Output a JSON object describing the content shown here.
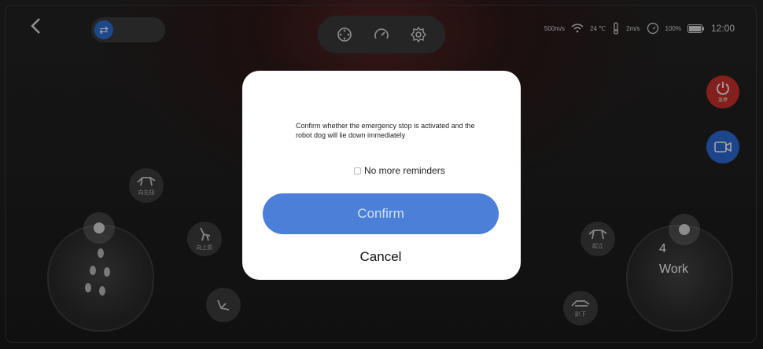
{
  "header": {
    "back_icon": "chevron-left-icon",
    "mode_toggle_icon": "swap-arrows-icon",
    "tools": [
      "crosshair-target-icon",
      "speedometer-icon",
      "gear-icon"
    ],
    "status": {
      "network": "500m/s",
      "temperature": "24 ℃",
      "speed": "2m/s",
      "battery": "100%",
      "time": "12:00"
    }
  },
  "side": {
    "estop_label": "急停",
    "camera_icon": "video-camera-icon"
  },
  "actions": {
    "left": [
      "向左扭",
      "向上抓",
      ""
    ],
    "right": [
      "起立",
      "趴下"
    ]
  },
  "joystick": {
    "speed_value": "4",
    "mode_label": "Work"
  },
  "dialog": {
    "message": "Confirm whether the emergency stop is activated and the robot dog will lie down immediately",
    "checkbox_label": "No more reminders",
    "checkbox_checked": false,
    "confirm_label": "Confirm",
    "cancel_label": "Cancel"
  },
  "colors": {
    "accent_blue": "#4b7fd8",
    "estop_red": "#c9302c",
    "camera_blue": "#2c6bd6"
  }
}
